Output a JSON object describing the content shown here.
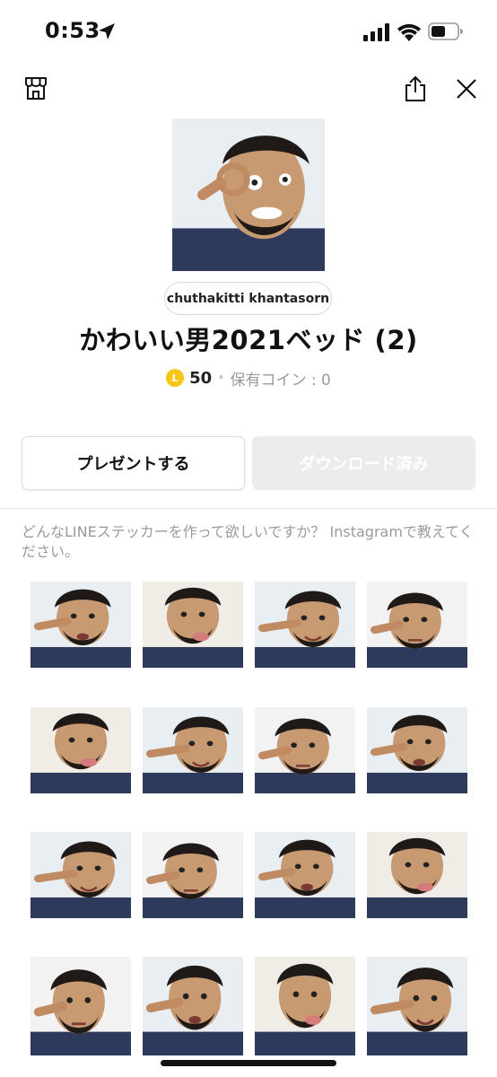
{
  "status_bar": {
    "time": "0:53",
    "location_icon": "location-arrow-icon",
    "signal_icon": "cellular-signal-icon",
    "wifi_icon": "wifi-icon",
    "battery_icon": "battery-icon"
  },
  "nav": {
    "shop_icon": "shop-icon",
    "share_icon": "share-icon",
    "close_icon": "close-icon"
  },
  "pack": {
    "author": "chuthakitti khantasorn",
    "title": "かわいい男2021ベッド (2)",
    "coin_symbol": "L",
    "price": "50",
    "separator": "•",
    "owned_coins": "保有コイン : 0"
  },
  "actions": {
    "present_label": "プレゼントする",
    "download_label": "ダウンロード済み"
  },
  "promo": {
    "text": "どんなLINEステッカーを作って欲しいですか？ Instagramで教えてください。"
  },
  "colors": {
    "coin": "#f5c518",
    "disabled_button": "#ececec",
    "muted_text": "#9a9a9a",
    "shirt": "#2d3a5c",
    "skin": "#c89a72",
    "hair": "#1f1a17",
    "pillow": "#e9eef2"
  }
}
